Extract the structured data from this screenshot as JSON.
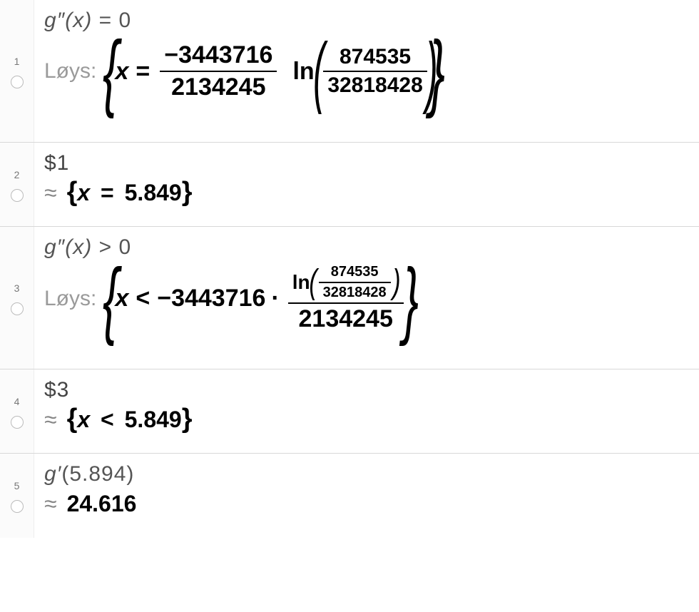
{
  "toolbutton": {
    "name": "symbolic-eval-icon",
    "xeq": "x="
  },
  "rows": [
    {
      "num": "1",
      "input": {
        "lhs": "g″(x)",
        "rel": "=",
        "rhs": "0"
      },
      "label": "Løys:",
      "solution": {
        "var": "x",
        "rel": "=",
        "coeff_num": "−3443716",
        "coeff_den": "2134245",
        "fn": "ln",
        "arg_num": "874535",
        "arg_den": "32818428"
      }
    },
    {
      "num": "2",
      "input_ref": "$1",
      "approx": {
        "var": "x",
        "rel": "=",
        "val": "5.849"
      }
    },
    {
      "num": "3",
      "input": {
        "lhs": "g″(x)",
        "rel": ">",
        "rhs": "0"
      },
      "label": "Løys:",
      "solution": {
        "var": "x",
        "rel": "<",
        "lead": "−3443716",
        "dot": "·",
        "fn": "ln",
        "arg_num": "874535",
        "arg_den": "32818428",
        "den": "2134245"
      }
    },
    {
      "num": "4",
      "input_ref": "$3",
      "approx": {
        "var": "x",
        "rel": "<",
        "val": "5.849"
      }
    },
    {
      "num": "5",
      "input_call": {
        "fn": "g′",
        "arg": "5.894"
      },
      "approx_val": "24.616"
    }
  ],
  "symbols": {
    "approx": "≈"
  }
}
